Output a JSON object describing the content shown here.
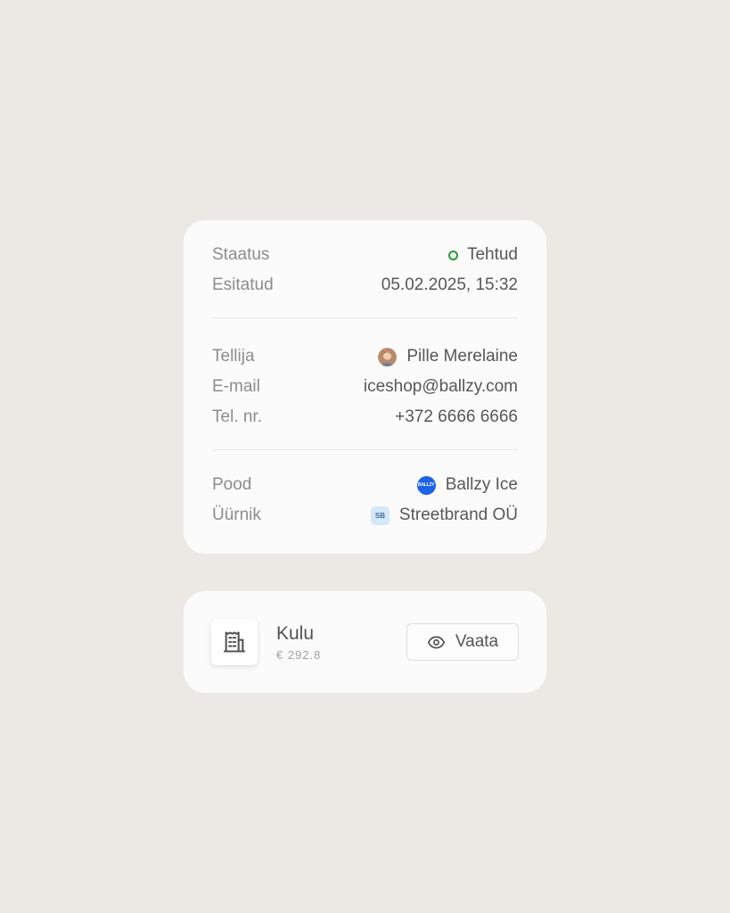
{
  "details": {
    "status": {
      "label": "Staatus",
      "value": "Tehtud",
      "color": "#1f9d35"
    },
    "submitted": {
      "label": "Esitatud",
      "value": "05.02.2025, 15:32"
    },
    "orderer": {
      "label": "Tellija",
      "value": "Pille Merelaine"
    },
    "email": {
      "label": "E-mail",
      "value": "iceshop@ballzy.com"
    },
    "phone": {
      "label": "Tel. nr.",
      "value": "+372 6666 6666"
    },
    "store": {
      "label": "Pood",
      "value": "Ballzy Ice",
      "logo_text": "BALLZY",
      "logo_color": "#1d63e8"
    },
    "tenant": {
      "label": "Üürnik",
      "value": "Streetbrand OÜ",
      "badge_text": "SB",
      "badge_color": "#d4e8f8"
    }
  },
  "expense": {
    "icon": "receipt-building-icon",
    "title": "Kulu",
    "amount": "€ 292.8",
    "view_button_label": "Vaata",
    "view_button_icon": "eye-icon"
  }
}
